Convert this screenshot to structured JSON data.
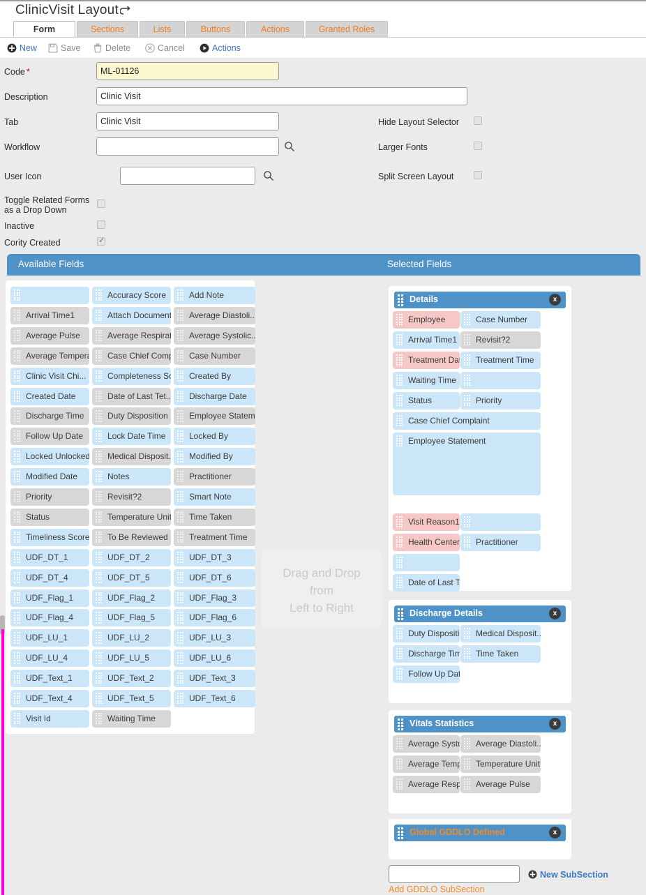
{
  "header": {
    "title": "ClinicVisit Layout",
    "back_icon": "back-arrow-icon"
  },
  "tabs": [
    {
      "label": "Form",
      "active": true
    },
    {
      "label": "Sections",
      "active": false
    },
    {
      "label": "Lists",
      "active": false
    },
    {
      "label": "Buttons",
      "active": false
    },
    {
      "label": "Actions",
      "active": false
    },
    {
      "label": "Granted Roles",
      "active": false
    }
  ],
  "toolbar": [
    {
      "label": "New",
      "icon": "plus-circle-icon",
      "enabled": true
    },
    {
      "label": "Save",
      "icon": "floppy-disk-icon",
      "enabled": false
    },
    {
      "label": "Delete",
      "icon": "trash-icon",
      "enabled": false
    },
    {
      "label": "Cancel",
      "icon": "cancel-circle-icon",
      "enabled": false
    },
    {
      "label": "Actions",
      "icon": "play-circle-icon",
      "enabled": true
    }
  ],
  "form": {
    "code_label": "Code",
    "code_required_mark": "*",
    "code_value": "ML-01126",
    "description_label": "Description",
    "description_value": "Clinic Visit",
    "tab_label": "Tab",
    "tab_value": "Clinic Visit",
    "workflow_label": "Workflow",
    "workflow_value": "",
    "user_icon_label": "User Icon",
    "user_icon_value": "",
    "hide_layout_selector_label": "Hide Layout Selector",
    "hide_layout_selector_checked": false,
    "larger_fonts_label": "Larger Fonts",
    "larger_fonts_checked": false,
    "split_screen_layout_label": "Split Screen Layout",
    "split_screen_layout_checked": false,
    "toggle_related_label_line1": "Toggle Related Forms",
    "toggle_related_label_line2": "as a Drop Down",
    "toggle_related_checked": false,
    "inactive_label": "Inactive",
    "inactive_checked": false,
    "cority_created_label": "Cority Created",
    "cority_created_checked": true
  },
  "band": {
    "available_title": "Available Fields",
    "selected_title": "Selected Fields",
    "color": "#4f92c8"
  },
  "dropzone": {
    "line1": "Drag and Drop",
    "line2": "from",
    "line3": "Left to Right"
  },
  "available_fields": [
    {
      "label": "",
      "color": "blue"
    },
    {
      "label": "Accuracy Score",
      "color": "blue"
    },
    {
      "label": "Add Note",
      "color": "blue"
    },
    {
      "label": "Arrival Time1",
      "color": "gray"
    },
    {
      "label": "Attach Document",
      "color": "blue"
    },
    {
      "label": "Average Diastoli...",
      "color": "gray"
    },
    {
      "label": "Average Pulse",
      "color": "gray"
    },
    {
      "label": "Average Respirat...",
      "color": "gray"
    },
    {
      "label": "Average Systolic...",
      "color": "gray"
    },
    {
      "label": "Average Temperat...",
      "color": "gray"
    },
    {
      "label": "Case Chief Compl...",
      "color": "gray"
    },
    {
      "label": "Case Number",
      "color": "gray"
    },
    {
      "label": "Clinic Visit Chi...",
      "color": "blue"
    },
    {
      "label": "Completeness Sco...",
      "color": "blue"
    },
    {
      "label": "Created By",
      "color": "blue"
    },
    {
      "label": "Created Date",
      "color": "blue"
    },
    {
      "label": "Date of Last Tet...",
      "color": "gray"
    },
    {
      "label": "Discharge Date",
      "color": "blue"
    },
    {
      "label": "Discharge Time",
      "color": "gray"
    },
    {
      "label": "Duty Disposition",
      "color": "gray"
    },
    {
      "label": "Employee Stateme...",
      "color": "gray"
    },
    {
      "label": "Follow Up Date",
      "color": "gray"
    },
    {
      "label": "Lock Date Time",
      "color": "blue"
    },
    {
      "label": "Locked By",
      "color": "blue"
    },
    {
      "label": "Locked Unlocked",
      "color": "blue"
    },
    {
      "label": "Medical Disposit...",
      "color": "gray"
    },
    {
      "label": "Modified By",
      "color": "blue"
    },
    {
      "label": "Modified Date",
      "color": "blue"
    },
    {
      "label": "Notes",
      "color": "blue"
    },
    {
      "label": "Practitioner",
      "color": "gray"
    },
    {
      "label": "Priority",
      "color": "gray"
    },
    {
      "label": "Revisit?2",
      "color": "gray"
    },
    {
      "label": "Smart Note",
      "color": "blue"
    },
    {
      "label": "Status",
      "color": "gray"
    },
    {
      "label": "Temperature Unit",
      "color": "gray"
    },
    {
      "label": "Time Taken",
      "color": "gray"
    },
    {
      "label": "Timeliness Score",
      "color": "blue"
    },
    {
      "label": "To Be Reviewed B...",
      "color": "gray"
    },
    {
      "label": "Treatment Time",
      "color": "gray"
    },
    {
      "label": "UDF_DT_1",
      "color": "blue"
    },
    {
      "label": "UDF_DT_2",
      "color": "blue"
    },
    {
      "label": "UDF_DT_3",
      "color": "blue"
    },
    {
      "label": "UDF_DT_4",
      "color": "blue"
    },
    {
      "label": "UDF_DT_5",
      "color": "blue"
    },
    {
      "label": "UDF_DT_6",
      "color": "blue"
    },
    {
      "label": "UDF_Flag_1",
      "color": "blue"
    },
    {
      "label": "UDF_Flag_2",
      "color": "blue"
    },
    {
      "label": "UDF_Flag_3",
      "color": "blue"
    },
    {
      "label": "UDF_Flag_4",
      "color": "blue"
    },
    {
      "label": "UDF_Flag_5",
      "color": "blue"
    },
    {
      "label": "UDF_Flag_6",
      "color": "blue"
    },
    {
      "label": "UDF_LU_1",
      "color": "blue"
    },
    {
      "label": "UDF_LU_2",
      "color": "blue"
    },
    {
      "label": "UDF_LU_3",
      "color": "blue"
    },
    {
      "label": "UDF_LU_4",
      "color": "blue"
    },
    {
      "label": "UDF_LU_5",
      "color": "blue"
    },
    {
      "label": "UDF_LU_6",
      "color": "blue"
    },
    {
      "label": "UDF_Text_1",
      "color": "blue"
    },
    {
      "label": "UDF_Text_2",
      "color": "blue"
    },
    {
      "label": "UDF_Text_3",
      "color": "blue"
    },
    {
      "label": "UDF_Text_4",
      "color": "blue"
    },
    {
      "label": "UDF_Text_5",
      "color": "blue"
    },
    {
      "label": "UDF_Text_6",
      "color": "blue"
    },
    {
      "label": "Visit Id",
      "color": "blue"
    },
    {
      "label": "Waiting Time",
      "color": "gray"
    }
  ],
  "selected_sections": [
    {
      "title": "Details",
      "title_color": "#ffffff",
      "close_label": "x",
      "fields": [
        {
          "label": "Employee",
          "color": "pink",
          "col": 0,
          "row": 0,
          "span": 1,
          "tall": false
        },
        {
          "label": "Case Number",
          "color": "blue",
          "col": 1,
          "row": 0,
          "span": 1,
          "tall": false
        },
        {
          "label": "Arrival Time1",
          "color": "blue",
          "col": 0,
          "row": 1,
          "span": 1,
          "tall": false
        },
        {
          "label": "Revisit?2",
          "color": "gray",
          "col": 1,
          "row": 1,
          "span": 1,
          "tall": false
        },
        {
          "label": "Treatment Date",
          "color": "pink",
          "col": 0,
          "row": 2,
          "span": 1,
          "tall": false
        },
        {
          "label": "Treatment Time",
          "color": "blue",
          "col": 1,
          "row": 2,
          "span": 1,
          "tall": false
        },
        {
          "label": "Waiting Time",
          "color": "blue",
          "col": 0,
          "row": 3,
          "span": 1,
          "tall": false
        },
        {
          "label": "",
          "color": "blue",
          "col": 1,
          "row": 3,
          "span": 1,
          "tall": false
        },
        {
          "label": "Status",
          "color": "blue",
          "col": 0,
          "row": 4,
          "span": 1,
          "tall": false
        },
        {
          "label": "Priority",
          "color": "blue",
          "col": 1,
          "row": 4,
          "span": 1,
          "tall": false
        },
        {
          "label": "Case Chief Complaint",
          "color": "blue",
          "col": 0,
          "row": 5,
          "span": 2,
          "tall": false
        },
        {
          "label": "Employee Statement",
          "color": "blue",
          "col": 0,
          "row": 6,
          "span": 2,
          "tall": true
        },
        {
          "label": "Visit Reason1",
          "color": "pink",
          "col": 0,
          "row": 10,
          "span": 1,
          "tall": false
        },
        {
          "label": "",
          "color": "blue",
          "col": 1,
          "row": 10,
          "span": 1,
          "tall": false
        },
        {
          "label": "Health Center",
          "color": "pink",
          "col": 0,
          "row": 11,
          "span": 1,
          "tall": false
        },
        {
          "label": "Practitioner",
          "color": "blue",
          "col": 1,
          "row": 11,
          "span": 1,
          "tall": false
        },
        {
          "label": "",
          "color": "blue",
          "col": 0,
          "row": 12,
          "span": 1,
          "tall": false
        },
        {
          "label": "Date of Last Tet...",
          "color": "blue",
          "col": 0,
          "row": 13,
          "span": 1,
          "tall": false
        }
      ]
    },
    {
      "title": "Discharge Details",
      "title_color": "#ffffff",
      "close_label": "x",
      "fields": [
        {
          "label": "Duty Disposition",
          "color": "blue",
          "col": 0,
          "row": 0,
          "span": 1,
          "tall": false
        },
        {
          "label": "Medical Disposit...",
          "color": "blue",
          "col": 1,
          "row": 0,
          "span": 1,
          "tall": false
        },
        {
          "label": "Discharge Time",
          "color": "blue",
          "col": 0,
          "row": 1,
          "span": 1,
          "tall": false
        },
        {
          "label": "Time Taken",
          "color": "blue",
          "col": 1,
          "row": 1,
          "span": 1,
          "tall": false
        },
        {
          "label": "Follow Up Date",
          "color": "blue",
          "col": 0,
          "row": 2,
          "span": 1,
          "tall": false
        }
      ]
    },
    {
      "title": "Vitals Statistics",
      "title_color": "#ffffff",
      "close_label": "x",
      "fields": [
        {
          "label": "Average Systolic...",
          "color": "gray",
          "col": 0,
          "row": 0,
          "span": 1,
          "tall": false
        },
        {
          "label": "Average Diastoli...",
          "color": "gray",
          "col": 1,
          "row": 0,
          "span": 1,
          "tall": false
        },
        {
          "label": "Average Temperat...",
          "color": "gray",
          "col": 0,
          "row": 1,
          "span": 1,
          "tall": false
        },
        {
          "label": "Temperature Unit",
          "color": "gray",
          "col": 1,
          "row": 1,
          "span": 1,
          "tall": false
        },
        {
          "label": "Average Respirat...",
          "color": "gray",
          "col": 0,
          "row": 2,
          "span": 1,
          "tall": false
        },
        {
          "label": "Average Pulse",
          "color": "gray",
          "col": 1,
          "row": 2,
          "span": 1,
          "tall": false
        }
      ]
    },
    {
      "title": "Global GDDLO Defined",
      "title_color": "#f08a2a",
      "close_label": "x",
      "fields": []
    }
  ],
  "footer": {
    "add_subsection_input_value": "",
    "new_subsection_label": "New SubSection",
    "new_subsection_icon": "plus-circle-icon",
    "add_gddlo_subsection_label": "Add GDDLO SubSection"
  }
}
